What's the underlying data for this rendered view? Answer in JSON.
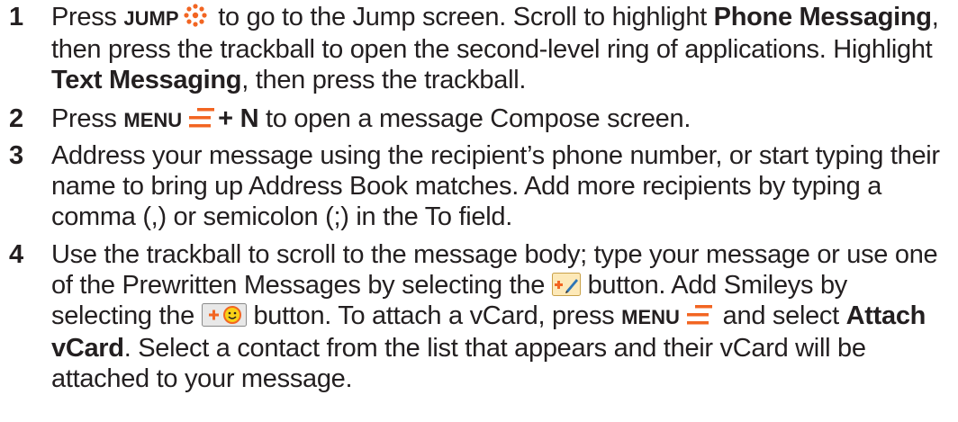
{
  "colors": {
    "accent": "#f26522",
    "text": "#231f20",
    "icon_green": "#8dc63f",
    "icon_blue": "#2e75b6"
  },
  "steps": [
    {
      "number": "1",
      "t1": "Press ",
      "k1": "JUMP",
      "icon1": "jump-dots-icon",
      "t2": " to go to the Jump screen. Scroll to highlight ",
      "b1": "Phone Messaging",
      "t3": ", then press the trackball to open the second-level ring of applications. Highlight ",
      "b2": "Text Messaging",
      "t4": ", then press the trackball."
    },
    {
      "number": "2",
      "t1": "Press ",
      "k1": "MENU",
      "icon1": "menu-icon",
      "b1": "+ N",
      "t2": " to open a message Compose screen."
    },
    {
      "number": "3",
      "t1": "Address your message using the recipient’s phone number, or start typing their name to bring up Address Book matches. Add more recipients by typing a comma (,) or semicolon (;) in the To field."
    },
    {
      "number": "4",
      "t1": "Use the trackball to scroll to the message body; type your message or use one of the Prewritten Messages by selecting the ",
      "icon1": "prewritten-message-icon",
      "t2": " button. Add Smileys by selecting the ",
      "icon2": "add-smiley-icon",
      "t3": " button. To attach a vCard, press ",
      "k1": "MENU",
      "icon3": "menu-icon",
      "t4": " and select ",
      "b1": "Attach vCard",
      "t5": ". Select a contact from the list that appears and their vCard will be attached to your message."
    }
  ]
}
